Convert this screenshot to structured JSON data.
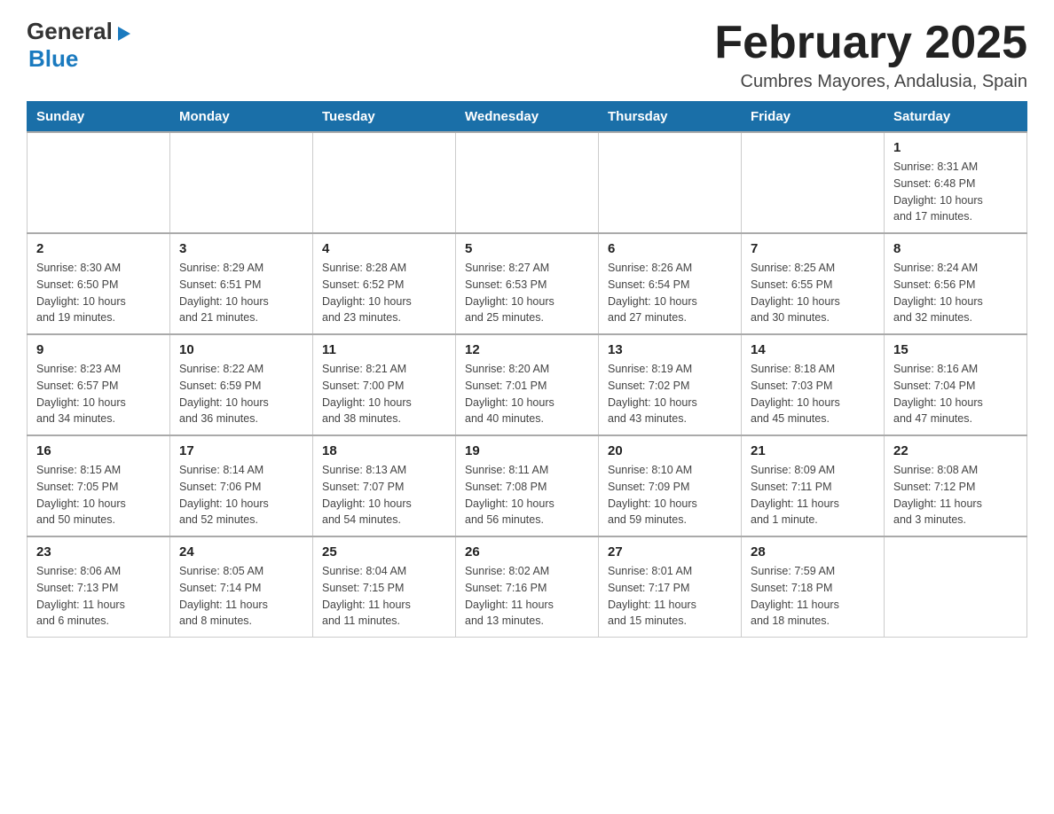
{
  "logo": {
    "general": "General",
    "blue": "Blue"
  },
  "title": "February 2025",
  "location": "Cumbres Mayores, Andalusia, Spain",
  "weekdays": [
    "Sunday",
    "Monday",
    "Tuesday",
    "Wednesday",
    "Thursday",
    "Friday",
    "Saturday"
  ],
  "weeks": [
    [
      {
        "day": "",
        "info": ""
      },
      {
        "day": "",
        "info": ""
      },
      {
        "day": "",
        "info": ""
      },
      {
        "day": "",
        "info": ""
      },
      {
        "day": "",
        "info": ""
      },
      {
        "day": "",
        "info": ""
      },
      {
        "day": "1",
        "info": "Sunrise: 8:31 AM\nSunset: 6:48 PM\nDaylight: 10 hours\nand 17 minutes."
      }
    ],
    [
      {
        "day": "2",
        "info": "Sunrise: 8:30 AM\nSunset: 6:50 PM\nDaylight: 10 hours\nand 19 minutes."
      },
      {
        "day": "3",
        "info": "Sunrise: 8:29 AM\nSunset: 6:51 PM\nDaylight: 10 hours\nand 21 minutes."
      },
      {
        "day": "4",
        "info": "Sunrise: 8:28 AM\nSunset: 6:52 PM\nDaylight: 10 hours\nand 23 minutes."
      },
      {
        "day": "5",
        "info": "Sunrise: 8:27 AM\nSunset: 6:53 PM\nDaylight: 10 hours\nand 25 minutes."
      },
      {
        "day": "6",
        "info": "Sunrise: 8:26 AM\nSunset: 6:54 PM\nDaylight: 10 hours\nand 27 minutes."
      },
      {
        "day": "7",
        "info": "Sunrise: 8:25 AM\nSunset: 6:55 PM\nDaylight: 10 hours\nand 30 minutes."
      },
      {
        "day": "8",
        "info": "Sunrise: 8:24 AM\nSunset: 6:56 PM\nDaylight: 10 hours\nand 32 minutes."
      }
    ],
    [
      {
        "day": "9",
        "info": "Sunrise: 8:23 AM\nSunset: 6:57 PM\nDaylight: 10 hours\nand 34 minutes."
      },
      {
        "day": "10",
        "info": "Sunrise: 8:22 AM\nSunset: 6:59 PM\nDaylight: 10 hours\nand 36 minutes."
      },
      {
        "day": "11",
        "info": "Sunrise: 8:21 AM\nSunset: 7:00 PM\nDaylight: 10 hours\nand 38 minutes."
      },
      {
        "day": "12",
        "info": "Sunrise: 8:20 AM\nSunset: 7:01 PM\nDaylight: 10 hours\nand 40 minutes."
      },
      {
        "day": "13",
        "info": "Sunrise: 8:19 AM\nSunset: 7:02 PM\nDaylight: 10 hours\nand 43 minutes."
      },
      {
        "day": "14",
        "info": "Sunrise: 8:18 AM\nSunset: 7:03 PM\nDaylight: 10 hours\nand 45 minutes."
      },
      {
        "day": "15",
        "info": "Sunrise: 8:16 AM\nSunset: 7:04 PM\nDaylight: 10 hours\nand 47 minutes."
      }
    ],
    [
      {
        "day": "16",
        "info": "Sunrise: 8:15 AM\nSunset: 7:05 PM\nDaylight: 10 hours\nand 50 minutes."
      },
      {
        "day": "17",
        "info": "Sunrise: 8:14 AM\nSunset: 7:06 PM\nDaylight: 10 hours\nand 52 minutes."
      },
      {
        "day": "18",
        "info": "Sunrise: 8:13 AM\nSunset: 7:07 PM\nDaylight: 10 hours\nand 54 minutes."
      },
      {
        "day": "19",
        "info": "Sunrise: 8:11 AM\nSunset: 7:08 PM\nDaylight: 10 hours\nand 56 minutes."
      },
      {
        "day": "20",
        "info": "Sunrise: 8:10 AM\nSunset: 7:09 PM\nDaylight: 10 hours\nand 59 minutes."
      },
      {
        "day": "21",
        "info": "Sunrise: 8:09 AM\nSunset: 7:11 PM\nDaylight: 11 hours\nand 1 minute."
      },
      {
        "day": "22",
        "info": "Sunrise: 8:08 AM\nSunset: 7:12 PM\nDaylight: 11 hours\nand 3 minutes."
      }
    ],
    [
      {
        "day": "23",
        "info": "Sunrise: 8:06 AM\nSunset: 7:13 PM\nDaylight: 11 hours\nand 6 minutes."
      },
      {
        "day": "24",
        "info": "Sunrise: 8:05 AM\nSunset: 7:14 PM\nDaylight: 11 hours\nand 8 minutes."
      },
      {
        "day": "25",
        "info": "Sunrise: 8:04 AM\nSunset: 7:15 PM\nDaylight: 11 hours\nand 11 minutes."
      },
      {
        "day": "26",
        "info": "Sunrise: 8:02 AM\nSunset: 7:16 PM\nDaylight: 11 hours\nand 13 minutes."
      },
      {
        "day": "27",
        "info": "Sunrise: 8:01 AM\nSunset: 7:17 PM\nDaylight: 11 hours\nand 15 minutes."
      },
      {
        "day": "28",
        "info": "Sunrise: 7:59 AM\nSunset: 7:18 PM\nDaylight: 11 hours\nand 18 minutes."
      },
      {
        "day": "",
        "info": ""
      }
    ]
  ]
}
